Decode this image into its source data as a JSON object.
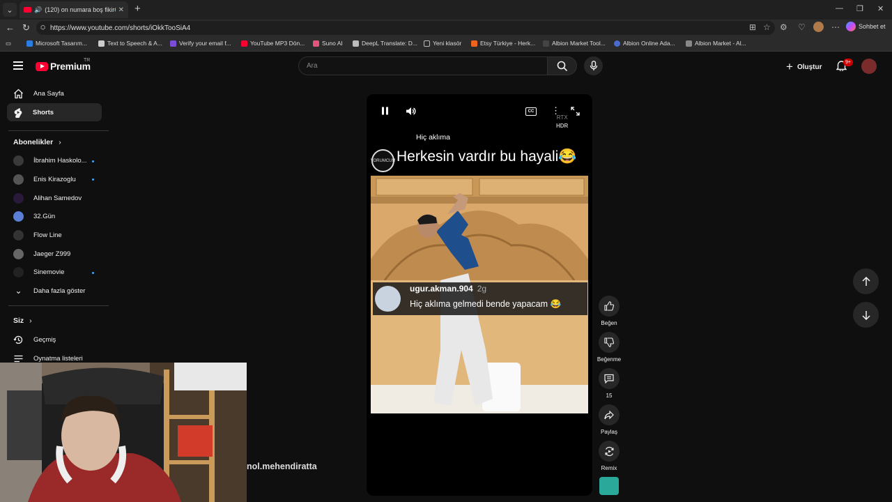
{
  "browser": {
    "tab_title": "(120) on numara boş fikir😂",
    "url": "https://www.youtube.com/shorts/iOkkTooSiA4",
    "copilot_label": "Sohbet et"
  },
  "bookmarks": [
    {
      "label": "Microsoft Tasarım...",
      "color": "#2a7de1"
    },
    {
      "label": "Text to Speech & A...",
      "color": "#cccccc"
    },
    {
      "label": "Verify your email f...",
      "color": "#7a4cd8"
    },
    {
      "label": "YouTube MP3 Dön...",
      "color": "#ff0033"
    },
    {
      "label": "Suno AI",
      "color": "#e0567a"
    },
    {
      "label": "DeepL Translate: D...",
      "color": "#bbbbbb"
    },
    {
      "label": "Yeni klasör",
      "color": "#bbbbbb"
    },
    {
      "label": "Etsy Türkiye - Herk...",
      "color": "#f1641e"
    },
    {
      "label": "Albion Market Tool...",
      "color": "#444444"
    },
    {
      "label": "Albion Online Ada...",
      "color": "#4a6cd0"
    },
    {
      "label": "Albion Market - Al...",
      "color": "#888888"
    }
  ],
  "header": {
    "logo_text": "Premium",
    "logo_region": "TR",
    "search_placeholder": "Ara",
    "create_label": "Oluştur",
    "notif_count": "9+"
  },
  "sidebar": {
    "main": [
      {
        "label": "Ana Sayfa",
        "icon": "home-icon"
      },
      {
        "label": "Shorts",
        "icon": "shorts-icon"
      }
    ],
    "subscriptions_title": "Abonelikler",
    "subscriptions": [
      {
        "label": "İbrahim Haskolo...",
        "color": "#3a3a3a",
        "new": true
      },
      {
        "label": "Enis Kirazoglu",
        "color": "#555555",
        "new": true
      },
      {
        "label": "Alihan Samedov",
        "color": "#2a1a3a",
        "new": false
      },
      {
        "label": "32.Gün",
        "color": "#5b7fd6",
        "new": false
      },
      {
        "label": "Flow Line",
        "color": "#333333",
        "new": false
      },
      {
        "label": "Jaeger Z999",
        "color": "#666666",
        "new": false
      },
      {
        "label": "Sinemovie",
        "color": "#222222",
        "new": true
      }
    ],
    "show_more": "Daha fazla göster",
    "you_title": "Siz",
    "you_items": [
      {
        "label": "Geçmiş",
        "icon": "history-icon"
      },
      {
        "label": "Oynatma listeleri",
        "icon": "playlist-icon"
      }
    ]
  },
  "short": {
    "caption_small": "Hiç aklıma",
    "caption_big": "Herkesin vardır bu hayali😂",
    "channel_logo_text": "YORUMCUM",
    "rtx": "RTX",
    "hdr": "HDR",
    "comment": {
      "user": "ugur.akman.904",
      "time": "2g",
      "text": "Hiç aklıma gelmedi bende yapacam 😂"
    },
    "creator_partial": "nol.mehendiratta"
  },
  "actions": {
    "like": "Beğen",
    "dislike": "Beğenme",
    "comments": "15",
    "share": "Paylaş",
    "remix": "Remix"
  }
}
